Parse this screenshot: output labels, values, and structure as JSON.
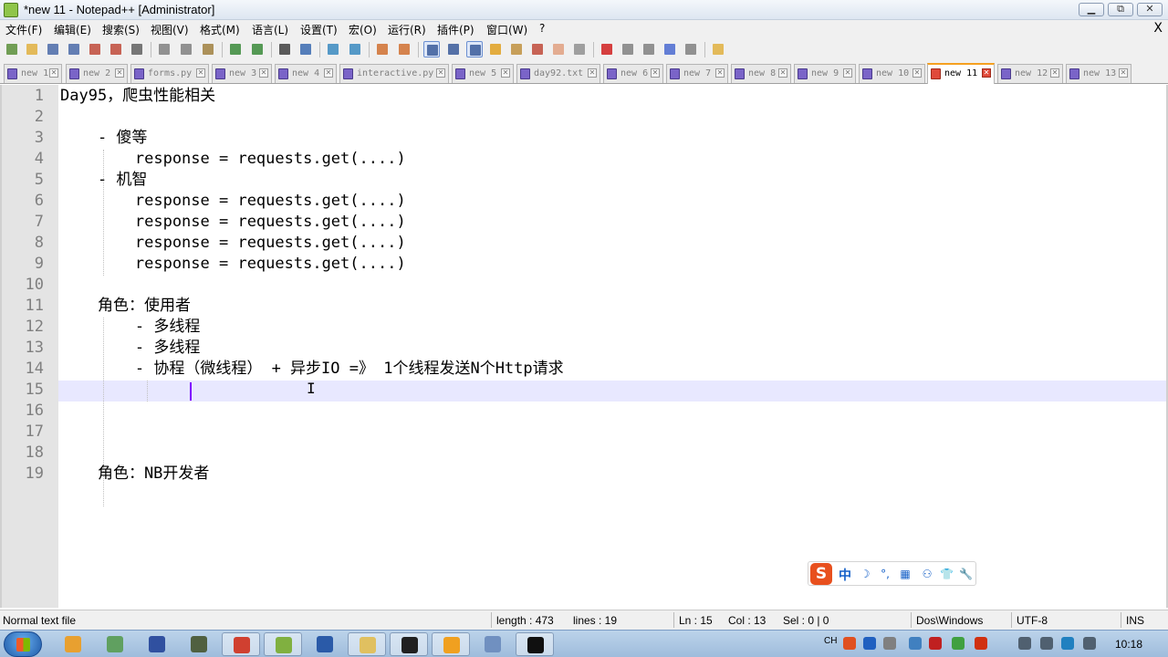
{
  "window": {
    "title": "*new 11 - Notepad++ [Administrator]",
    "buttons": {
      "minimize": "▁",
      "maximize": "⧉",
      "close": "✕"
    }
  },
  "menu": {
    "items": [
      "文件(F)",
      "编辑(E)",
      "搜索(S)",
      "视图(V)",
      "格式(M)",
      "语言(L)",
      "设置(T)",
      "宏(O)",
      "运行(R)",
      "插件(P)",
      "窗口(W)",
      "?"
    ],
    "close": "X"
  },
  "toolbar": {
    "icons": [
      "new-file-icon",
      "open-file-icon",
      "save-icon",
      "save-all-icon",
      "close-icon",
      "close-all-icon",
      "print-icon",
      "cut-icon",
      "copy-icon",
      "paste-icon",
      "undo-icon",
      "redo-icon",
      "find-icon",
      "replace-icon",
      "zoom-in-icon",
      "zoom-out-icon",
      "sync-vertical-icon",
      "sync-horizontal-icon",
      "word-wrap-icon",
      "show-all-chars-icon",
      "indent-guide-icon",
      "user-lang-icon",
      "doc-map-icon",
      "function-list-icon",
      "folder-workspace-icon",
      "monitoring-icon",
      "record-macro-icon",
      "stop-record-icon",
      "play-macro-icon",
      "run-macro-multiple-icon",
      "save-macro-icon",
      "plugin-icon"
    ]
  },
  "tabs": [
    {
      "label": "new 1",
      "active": false
    },
    {
      "label": "new 2",
      "active": false
    },
    {
      "label": "forms.py",
      "active": false
    },
    {
      "label": "new 3",
      "active": false
    },
    {
      "label": "new 4",
      "active": false
    },
    {
      "label": "interactive.py",
      "active": false
    },
    {
      "label": "new 5",
      "active": false
    },
    {
      "label": "day92.txt",
      "active": false
    },
    {
      "label": "new 6",
      "active": false
    },
    {
      "label": "new 7",
      "active": false
    },
    {
      "label": "new 8",
      "active": false
    },
    {
      "label": "new 9",
      "active": false
    },
    {
      "label": "new 10",
      "active": false
    },
    {
      "label": "new 11",
      "active": true
    },
    {
      "label": "new 12",
      "active": false
    },
    {
      "label": "new 13",
      "active": false
    }
  ],
  "tab_close_glyph": "✕",
  "editor": {
    "lines": [
      "Day95，爬虫性能相关",
      "",
      "    - 傻等",
      "        response = requests.get(....)",
      "    - 机智",
      "        response = requests.get(....)",
      "        response = requests.get(....)",
      "        response = requests.get(....)",
      "        response = requests.get(....)",
      "",
      "    角色：使用者",
      "        - 多线程",
      "        - 多线程",
      "        - 协程（微线程） + 异步IO =》 1个线程发送N个Http请求",
      "",
      "",
      "",
      "",
      "    角色：NB开发者"
    ],
    "line_numbers": [
      "1",
      "2",
      "3",
      "4",
      "5",
      "6",
      "7",
      "8",
      "9",
      "10",
      "11",
      "12",
      "13",
      "14",
      "15",
      "16",
      "17",
      "18",
      "19"
    ],
    "current_line": 15,
    "cursor_glyph": "I"
  },
  "ime": {
    "logo": "S",
    "lang": "中",
    "icons": [
      "moon-icon",
      "punctuation-icon",
      "keyboard-icon",
      "user-icon",
      "skin-icon",
      "settings-icon"
    ],
    "glyphs": [
      "☽",
      "°,",
      "▦",
      "⚇",
      "👕",
      "🔧"
    ]
  },
  "status": {
    "file_type": "Normal text file",
    "length": "length : 473",
    "lines": "lines : 19",
    "ln": "Ln : 15",
    "col": "Col : 13",
    "sel": "Sel : 0 | 0",
    "eol": "Dos\\Windows",
    "encoding": "UTF-8",
    "mode": "INS"
  },
  "taskbar": {
    "apps": [
      "chrome-like-icon",
      "app-icon",
      "save-disk-icon",
      "tool-icon",
      "chrome-icon",
      "notepadpp-icon",
      "word-icon",
      "explorer-icon",
      "pycharm-icon",
      "sticky-icon",
      "network-icon",
      "cmd-icon"
    ],
    "tray_lang": "CH",
    "clock": "10:18"
  },
  "colors": {
    "current_line": "#e8e8ff",
    "gutter": "#e4e4e4",
    "active_tab_accent": "#f5a020",
    "caret": "#8000ff"
  }
}
